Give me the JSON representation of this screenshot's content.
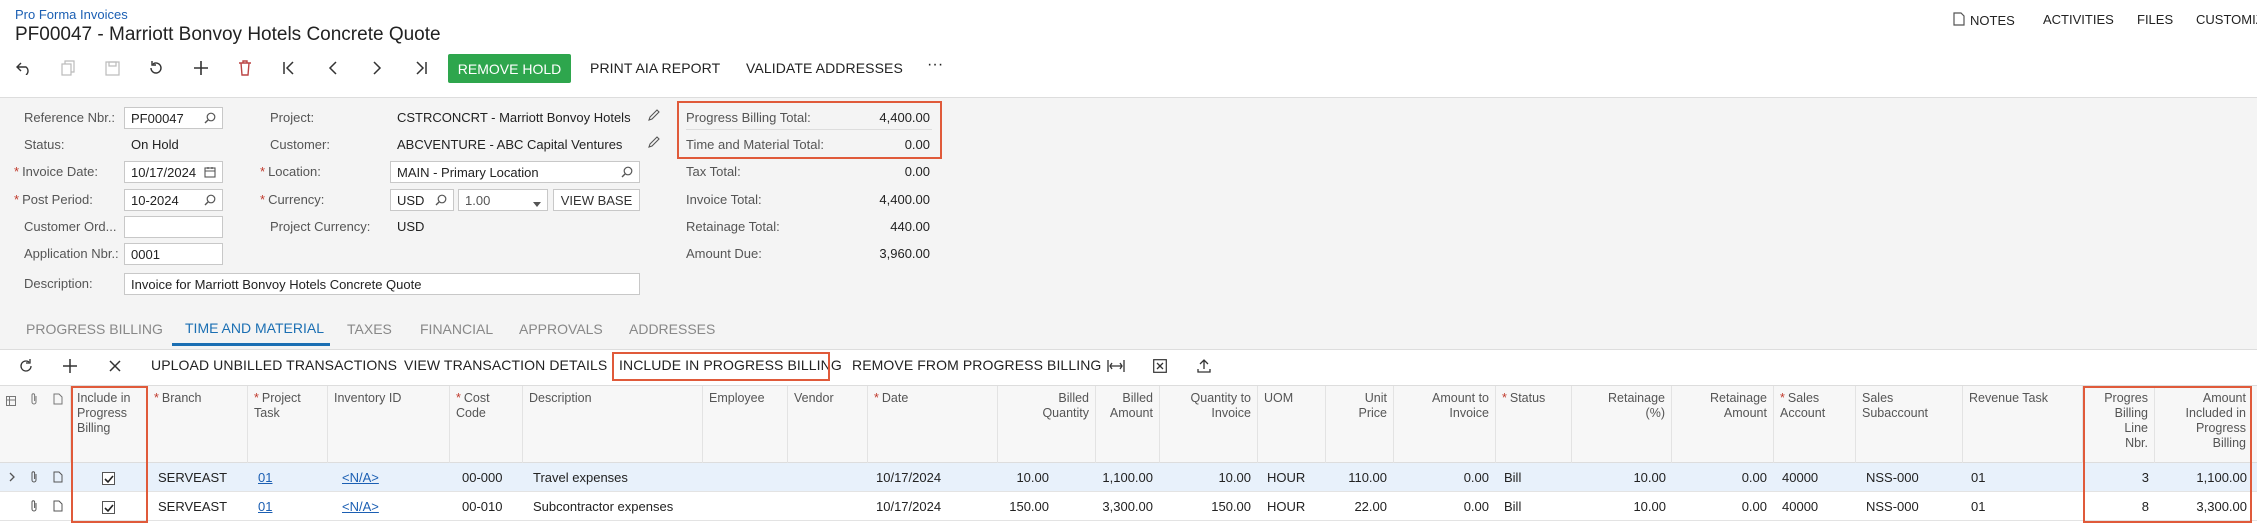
{
  "header": {
    "breadcrumb": "Pro Forma Invoices",
    "title": "PF00047 - Marriott Bonvoy Hotels Concrete Quote",
    "right_links": [
      "NOTES",
      "ACTIVITIES",
      "FILES",
      "CUSTOMIZ"
    ]
  },
  "toolbar": {
    "remove_hold": "REMOVE HOLD",
    "print_aia": "PRINT AIA REPORT",
    "validate": "VALIDATE ADDRESSES",
    "more": "···"
  },
  "form": {
    "ref_label": "Reference Nbr.:",
    "ref_value": "PF00047",
    "status_label": "Status:",
    "status_value": "On Hold",
    "invdate_label": "Invoice Date:",
    "invdate_value": "10/17/2024",
    "postperiod_label": "Post Period:",
    "postperiod_value": "10-2024",
    "custord_label": "Customer Ord...",
    "custord_value": "",
    "appnbr_label": "Application Nbr.:",
    "appnbr_value": "0001",
    "desc_label": "Description:",
    "desc_value": "Invoice for Marriott Bonvoy Hotels Concrete Quote",
    "project_label": "Project:",
    "project_value": "CSTRCONCRT - Marriott Bonvoy Hotels",
    "customer_label": "Customer:",
    "customer_value": "ABCVENTURE - ABC Capital Ventures",
    "location_label": "Location:",
    "location_value": "MAIN - Primary Location",
    "currency_label": "Currency:",
    "currency_value": "USD",
    "rate_value": "1.00",
    "view_base": "VIEW BASE",
    "projcur_label": "Project Currency:",
    "projcur_value": "USD"
  },
  "totals": [
    {
      "label": "Progress Billing Total:",
      "value": "4,400.00"
    },
    {
      "label": "Time and Material Total:",
      "value": "0.00"
    },
    {
      "label": "Tax Total:",
      "value": "0.00"
    },
    {
      "label": "Invoice Total:",
      "value": "4,400.00"
    },
    {
      "label": "Retainage Total:",
      "value": "440.00"
    },
    {
      "label": "Amount Due:",
      "value": "3,960.00"
    }
  ],
  "tabs": [
    "PROGRESS BILLING",
    "TIME AND MATERIAL",
    "TAXES",
    "FINANCIAL",
    "APPROVALS",
    "ADDRESSES"
  ],
  "grid_toolbar": {
    "upload": "UPLOAD UNBILLED TRANSACTIONS",
    "view": "VIEW TRANSACTION DETAILS",
    "include": "INCLUDE IN PROGRESS BILLING",
    "remove": "REMOVE FROM PROGRESS BILLING"
  },
  "columns": {
    "include": [
      "Include in",
      "Progress",
      "Billing"
    ],
    "branch": "Branch",
    "task": [
      "Project",
      "Task"
    ],
    "inventory": "Inventory ID",
    "cost": [
      "Cost",
      "Code"
    ],
    "description": "Description",
    "employee": "Employee",
    "vendor": "Vendor",
    "date": "Date",
    "billed_qty": [
      "Billed",
      "Quantity"
    ],
    "billed_amt": [
      "Billed",
      "Amount"
    ],
    "qty_inv": [
      "Quantity to",
      "Invoice"
    ],
    "uom": "UOM",
    "unit_price": [
      "Unit",
      "Price"
    ],
    "amt_inv": [
      "Amount to",
      "Invoice"
    ],
    "status": "Status",
    "retainage_pct": [
      "Retainage",
      "(%)"
    ],
    "retainage_amt": [
      "Retainage",
      "Amount"
    ],
    "sales_acct": [
      "Sales",
      "Account"
    ],
    "sales_sub": [
      "Sales",
      "Subaccount"
    ],
    "revenue_task": "Revenue Task",
    "pb_line": [
      "Progres",
      "Billing",
      "Line",
      "Nbr."
    ],
    "amt_incl": [
      "Amount",
      "Included in",
      "Progress",
      "Billing"
    ]
  },
  "rows": [
    {
      "included": true,
      "branch": "SERVEAST",
      "task": "01",
      "inventory": "<N/A>",
      "cost": "00-000",
      "description": "Travel expenses",
      "employee": "",
      "vendor": "",
      "date": "10/17/2024",
      "billed_qty": "10.00",
      "billed_amt": "1,100.00",
      "qty_inv": "10.00",
      "uom": "HOUR",
      "unit_price": "110.00",
      "amt_inv": "0.00",
      "status": "Bill",
      "retainage_pct": "10.00",
      "retainage_amt": "0.00",
      "sales_acct": "40000",
      "sales_sub": "NSS-000",
      "revenue_task": "01",
      "pb_line": "3",
      "amt_incl": "1,100.00"
    },
    {
      "included": true,
      "branch": "SERVEAST",
      "task": "01",
      "inventory": "<N/A>",
      "cost": "00-010",
      "description": "Subcontractor expenses",
      "employee": "",
      "vendor": "",
      "date": "10/17/2024",
      "billed_qty": "150.00",
      "billed_amt": "3,300.00",
      "qty_inv": "150.00",
      "uom": "HOUR",
      "unit_price": "22.00",
      "amt_inv": "0.00",
      "status": "Bill",
      "retainage_pct": "10.00",
      "retainage_amt": "0.00",
      "sales_acct": "40000",
      "sales_sub": "NSS-000",
      "revenue_task": "01",
      "pb_line": "8",
      "amt_incl": "3,300.00"
    }
  ]
}
